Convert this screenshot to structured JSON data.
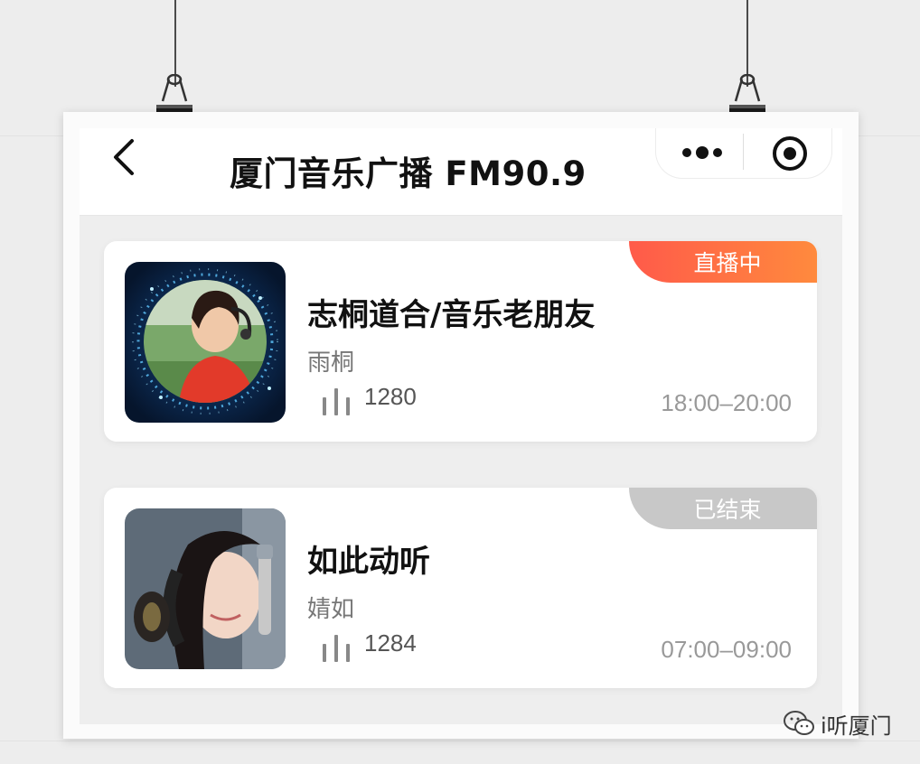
{
  "header": {
    "title": "厦门音乐广播 FM90.9"
  },
  "programs": [
    {
      "title": "志桐道合/音乐老朋友",
      "host": "雨桐",
      "listens": "1280",
      "time": "18:00–20:00",
      "status": "直播中",
      "status_color": "#ff6b3d"
    },
    {
      "title": "如此动听",
      "host": "婧如",
      "listens": "1284",
      "time": "07:00–09:00",
      "status": "已结束",
      "status_color": "#c8c8c8"
    }
  ],
  "watermark": {
    "text": "i听厦门"
  },
  "colors": {
    "live_gradient_start": "#ff5a4a",
    "live_gradient_end": "#ff8a3d"
  }
}
